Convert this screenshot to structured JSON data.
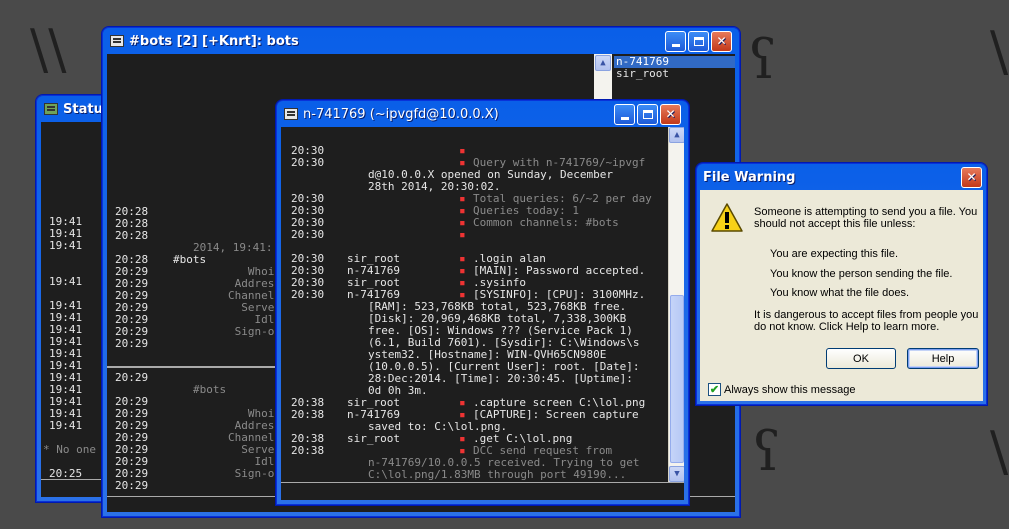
{
  "status_window": {
    "title": "Status:",
    "times": [
      "19:41",
      "19:41",
      "19:41",
      "",
      "",
      "19:41",
      "",
      "19:41",
      "19:41",
      "19:41",
      "19:41",
      "19:41",
      "19:41",
      "19:41",
      "19:41",
      "19:41",
      "19:41",
      "19:41"
    ],
    "no_one": "* No one",
    "last_time": "20:25"
  },
  "bots_window": {
    "title": "#bots [2] [+Knrt]: bots",
    "nicklist": [
      "n-741769",
      "sir_root"
    ],
    "upper_lines": [
      {
        "time": "20:28",
        "text": ""
      },
      {
        "time": "20:28",
        "text": ""
      },
      {
        "time": "20:28",
        "text": ""
      },
      {
        "time": "",
        "text": "2014, 19:41:"
      },
      {
        "time": "20:28",
        "text": "#bots"
      },
      {
        "time": "20:29",
        "text": "Whois"
      },
      {
        "time": "20:29",
        "text": "Address"
      },
      {
        "time": "20:29",
        "text": "Channels"
      },
      {
        "time": "20:29",
        "text": "Server"
      },
      {
        "time": "20:29",
        "text": "Idle"
      },
      {
        "time": "20:29",
        "text": "Sign-on"
      },
      {
        "time": "20:29",
        "text": ""
      }
    ],
    "lower_lines": [
      {
        "time": "20:29",
        "text": ""
      },
      {
        "time": "",
        "text": "#bots"
      },
      {
        "time": "20:29",
        "text": ""
      },
      {
        "time": "20:29",
        "text": "Whois"
      },
      {
        "time": "20:29",
        "text": "Address"
      },
      {
        "time": "20:29",
        "text": "Channels"
      },
      {
        "time": "20:29",
        "text": "Server"
      },
      {
        "time": "20:29",
        "text": "Idle"
      },
      {
        "time": "20:29",
        "text": "Sign-on"
      },
      {
        "time": "20:29",
        "text": ""
      }
    ]
  },
  "query_window": {
    "title": "n-741769 (~ipvgfd@10.0.0.X)",
    "lines": [
      {
        "time": "20:30",
        "nick": "",
        "marker": "▪",
        "text": "",
        "cls": ""
      },
      {
        "time": "20:30",
        "nick": "",
        "marker": "▪",
        "text": "Query with n-741769/~ipvgf",
        "cls": "dim"
      },
      {
        "time": "",
        "nick": "",
        "marker": "",
        "text": "d@10.0.0.X opened on Sunday, December",
        "cls": "cont"
      },
      {
        "time": "",
        "nick": "",
        "marker": "",
        "text": "28th 2014, 20:30:02.",
        "cls": "cont"
      },
      {
        "time": "20:30",
        "nick": "",
        "marker": "▪",
        "text": "Total queries: 6/~2 per day",
        "cls": "dim"
      },
      {
        "time": "20:30",
        "nick": "",
        "marker": "▪",
        "text": "Queries today: 1",
        "cls": "dim"
      },
      {
        "time": "20:30",
        "nick": "",
        "marker": "▪",
        "text": "Common channels: #bots",
        "cls": "dim"
      },
      {
        "time": "20:30",
        "nick": "",
        "marker": "▪",
        "text": "",
        "cls": ""
      },
      {
        "time": "",
        "nick": "",
        "marker": "",
        "text": "",
        "cls": ""
      },
      {
        "time": "20:30",
        "nick": "sir_root",
        "marker": "▪",
        "text": ".login alan",
        "cls": ""
      },
      {
        "time": "20:30",
        "nick": "n-741769",
        "marker": "▪",
        "text": "[MAIN]: Password accepted.",
        "cls": ""
      },
      {
        "time": "20:30",
        "nick": "sir_root",
        "marker": "▪",
        "text": ".sysinfo",
        "cls": ""
      },
      {
        "time": "20:30",
        "nick": "n-741769",
        "marker": "▪",
        "text": "[SYSINFO]: [CPU]: 3100MHz.",
        "cls": ""
      },
      {
        "time": "",
        "nick": "",
        "marker": "",
        "text": "[RAM]: 523,768KB total, 523,768KB free.",
        "cls": "cont"
      },
      {
        "time": "",
        "nick": "",
        "marker": "",
        "text": "[Disk]: 20,969,468KB total, 7,338,300KB",
        "cls": "cont"
      },
      {
        "time": "",
        "nick": "",
        "marker": "",
        "text": "free. [OS]: Windows ??? (Service Pack 1)",
        "cls": "cont"
      },
      {
        "time": "",
        "nick": "",
        "marker": "",
        "text": "(6.1, Build 7601). [Sysdir]: C:\\Windows\\s",
        "cls": "cont"
      },
      {
        "time": "",
        "nick": "",
        "marker": "",
        "text": "ystem32. [Hostname]: WIN-QVH65CN980E",
        "cls": "cont"
      },
      {
        "time": "",
        "nick": "",
        "marker": "",
        "text": "(10.0.0.5). [Current User]: root. [Date]:",
        "cls": "cont"
      },
      {
        "time": "",
        "nick": "",
        "marker": "",
        "text": "28:Dec:2014. [Time]: 20:30:45. [Uptime]:",
        "cls": "cont"
      },
      {
        "time": "",
        "nick": "",
        "marker": "",
        "text": "0d 0h 3m.",
        "cls": "cont"
      },
      {
        "time": "20:38",
        "nick": "sir_root",
        "marker": "▪",
        "text": ".capture screen C:\\lol.png",
        "cls": ""
      },
      {
        "time": "20:38",
        "nick": "n-741769",
        "marker": "▪",
        "text": "[CAPTURE]: Screen capture",
        "cls": ""
      },
      {
        "time": "",
        "nick": "",
        "marker": "",
        "text": "saved to: C:\\lol.png.",
        "cls": "cont"
      },
      {
        "time": "20:38",
        "nick": "sir_root",
        "marker": "▪",
        "text": ".get C:\\lol.png",
        "cls": ""
      },
      {
        "time": "20:38",
        "nick": "",
        "marker": "▪",
        "text": "DCC send request from",
        "cls": "dim"
      },
      {
        "time": "",
        "nick": "",
        "marker": "",
        "text": "n-741769/10.0.0.5 received. Trying to get",
        "cls": "cont-dim"
      },
      {
        "time": "",
        "nick": "",
        "marker": "",
        "text": "C:\\lol.png/1.83MB through port 49190...",
        "cls": "cont-dim"
      }
    ]
  },
  "file_warning": {
    "title": "File Warning",
    "intro": "Someone is attempting to send you a file. You should not accept this file unless:",
    "conditions": [
      "You are expecting this file.",
      "You know the person sending the file.",
      "You know what the file does."
    ],
    "danger": "It is dangerous to accept files from people you do not know. Click Help to learn more.",
    "ok_label": "OK",
    "help_label": "Help",
    "checkbox_label": "Always show this message",
    "checkbox_checked": true
  }
}
